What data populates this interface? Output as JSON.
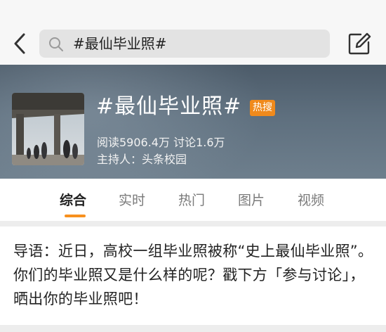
{
  "search": {
    "query": "#最仙毕业照#"
  },
  "topic": {
    "title": "#最仙毕业照#",
    "badge": "热搜",
    "stats": "阅读5906.4万  讨论1.6万",
    "host": "主持人：头条校园"
  },
  "tabs": [
    {
      "label": "综合",
      "active": true
    },
    {
      "label": "实时",
      "active": false
    },
    {
      "label": "热门",
      "active": false
    },
    {
      "label": "图片",
      "active": false
    },
    {
      "label": "视频",
      "active": false
    }
  ],
  "intro": {
    "text": "导语：近日，高校一组毕业照被称“史上最仙毕业照”。你们的毕业照又是什么样的呢？戳下方「参与讨论」，晒出你的毕业照吧！"
  },
  "colors": {
    "accent": "#f7901e",
    "hot_badge": "#f08a1c",
    "hero_bg": "#5e6f7e"
  },
  "icons": {
    "back": "chevron-left-icon",
    "search": "search-icon",
    "compose": "compose-icon"
  }
}
